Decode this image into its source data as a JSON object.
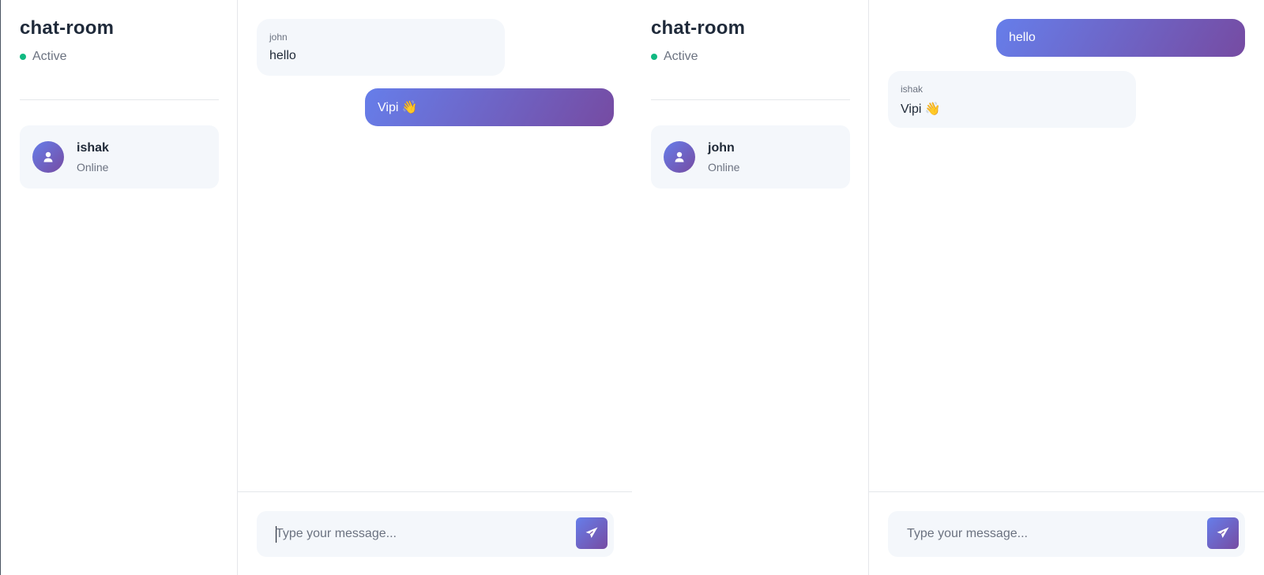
{
  "colors": {
    "accent_start": "#667eea",
    "accent_end": "#764ba2",
    "online": "#10b981"
  },
  "windows": [
    {
      "room": {
        "title": "chat-room",
        "status": "Active"
      },
      "contact": {
        "name": "ishak",
        "status": "Online"
      },
      "messages": [
        {
          "direction": "incoming",
          "author": "john",
          "text": "hello"
        },
        {
          "direction": "outgoing",
          "text": "Vipi 👋"
        }
      ],
      "composer": {
        "placeholder": "Type your message...",
        "value": ""
      },
      "icons": {
        "avatar": "user-icon",
        "send": "paper-plane-icon"
      }
    },
    {
      "room": {
        "title": "chat-room",
        "status": "Active"
      },
      "contact": {
        "name": "john",
        "status": "Online"
      },
      "messages": [
        {
          "direction": "outgoing",
          "text": "hello"
        },
        {
          "direction": "incoming",
          "author": "ishak",
          "text": "Vipi 👋"
        }
      ],
      "composer": {
        "placeholder": "Type your message...",
        "value": ""
      },
      "icons": {
        "avatar": "user-icon",
        "send": "paper-plane-icon"
      }
    }
  ]
}
